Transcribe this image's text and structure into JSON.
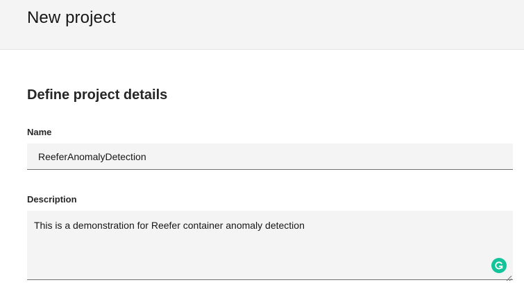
{
  "header": {
    "title": "New project"
  },
  "main": {
    "section_title": "Define project details",
    "name_field": {
      "label": "Name",
      "value": "ReeferAnomalyDetection"
    },
    "description_field": {
      "label": "Description",
      "value": "This is a demonstration for Reefer container anomaly detection"
    }
  },
  "icons": {
    "grammarly": "grammarly-icon",
    "resize": "resize-handle-icon"
  },
  "colors": {
    "header_bg": "#f4f4f4",
    "field_bg": "#f4f4f4",
    "field_border": "#6f6f6f",
    "grammarly_green": "#15c39a"
  }
}
